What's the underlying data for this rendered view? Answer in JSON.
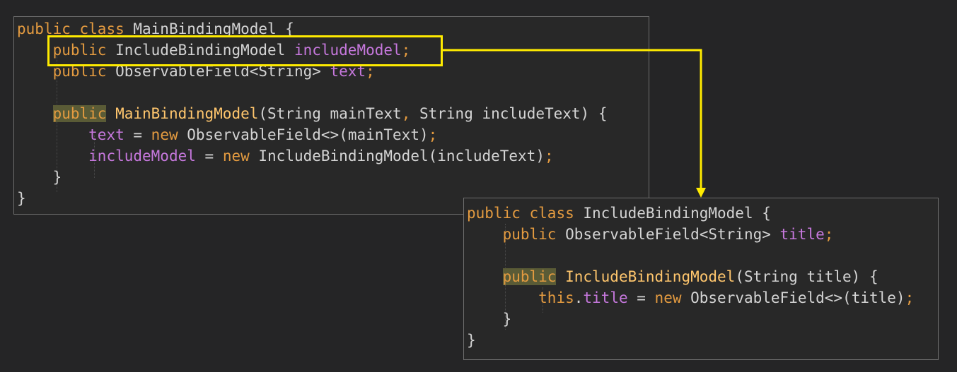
{
  "main_class": {
    "lines": [
      [
        {
          "t": "public",
          "c": "kw"
        },
        {
          "t": " ",
          "c": "plain"
        },
        {
          "t": "class",
          "c": "kw"
        },
        {
          "t": " MainBindingModel {",
          "c": "plain"
        }
      ],
      [
        {
          "t": "    ",
          "c": "plain"
        },
        {
          "t": "public",
          "c": "kw"
        },
        {
          "t": " IncludeBindingModel ",
          "c": "plain"
        },
        {
          "t": "includeModel",
          "c": "field"
        },
        {
          "t": ";",
          "c": "kw"
        }
      ],
      [
        {
          "t": "    ",
          "c": "plain"
        },
        {
          "t": "public",
          "c": "kw"
        },
        {
          "t": " ObservableField<String> ",
          "c": "plain"
        },
        {
          "t": "text",
          "c": "field"
        },
        {
          "t": ";",
          "c": "kw"
        }
      ],
      [],
      [
        {
          "t": "    ",
          "c": "plain"
        },
        {
          "t": "public",
          "c": "kw hl"
        },
        {
          "t": " ",
          "c": "plain"
        },
        {
          "t": "MainBindingModel",
          "c": "fn"
        },
        {
          "t": "(String mainText",
          "c": "plain"
        },
        {
          "t": ",",
          "c": "kw"
        },
        {
          "t": " String includeText) {",
          "c": "plain"
        }
      ],
      [
        {
          "t": "        ",
          "c": "plain"
        },
        {
          "t": "text",
          "c": "field"
        },
        {
          "t": " = ",
          "c": "plain"
        },
        {
          "t": "new",
          "c": "kw"
        },
        {
          "t": " ObservableField<>(mainText)",
          "c": "plain"
        },
        {
          "t": ";",
          "c": "kw"
        }
      ],
      [
        {
          "t": "        ",
          "c": "plain"
        },
        {
          "t": "includeModel",
          "c": "field"
        },
        {
          "t": " = ",
          "c": "plain"
        },
        {
          "t": "new",
          "c": "kw"
        },
        {
          "t": " IncludeBindingModel(includeText)",
          "c": "plain"
        },
        {
          "t": ";",
          "c": "kw"
        }
      ],
      [
        {
          "t": "    }",
          "c": "plain"
        }
      ],
      [
        {
          "t": "}",
          "c": "plain"
        }
      ]
    ]
  },
  "include_class": {
    "lines": [
      [
        {
          "t": "public",
          "c": "kw"
        },
        {
          "t": " ",
          "c": "plain"
        },
        {
          "t": "class",
          "c": "kw"
        },
        {
          "t": " IncludeBindingModel {",
          "c": "plain"
        }
      ],
      [
        {
          "t": "    ",
          "c": "plain"
        },
        {
          "t": "public",
          "c": "kw"
        },
        {
          "t": " ObservableField<String> ",
          "c": "plain"
        },
        {
          "t": "title",
          "c": "field"
        },
        {
          "t": ";",
          "c": "kw"
        }
      ],
      [],
      [
        {
          "t": "    ",
          "c": "plain"
        },
        {
          "t": "public",
          "c": "kw hl"
        },
        {
          "t": " ",
          "c": "plain"
        },
        {
          "t": "IncludeBindingModel",
          "c": "fn"
        },
        {
          "t": "(String title) {",
          "c": "plain"
        }
      ],
      [
        {
          "t": "        ",
          "c": "plain"
        },
        {
          "t": "this",
          "c": "kw"
        },
        {
          "t": ".",
          "c": "plain"
        },
        {
          "t": "title",
          "c": "field"
        },
        {
          "t": " = ",
          "c": "plain"
        },
        {
          "t": "new",
          "c": "kw"
        },
        {
          "t": " ObservableField<>(title)",
          "c": "plain"
        },
        {
          "t": ";",
          "c": "kw"
        }
      ],
      [
        {
          "t": "    }",
          "c": "plain"
        }
      ],
      [
        {
          "t": "}",
          "c": "plain"
        }
      ]
    ]
  },
  "colors": {
    "background": "#252526",
    "keyword": "#e49b40",
    "method": "#ffc66d",
    "field": "#c678dd",
    "text": "#d4d4d4",
    "highlight": "#ffeb00"
  }
}
